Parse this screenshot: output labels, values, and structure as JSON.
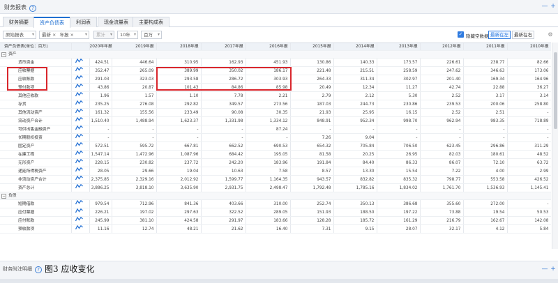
{
  "header": {
    "title": "财务报表"
  },
  "tabs": [
    "财务摘要",
    "资产负债表",
    "利润表",
    "现金流量表",
    "主要构成表"
  ],
  "toolbar": {
    "report_type": "原始报表",
    "chip_latest": "最新",
    "chip_annual": "年报",
    "period_placeholder": "累计",
    "count": "10年",
    "unit": "百万",
    "hide_empty_label": "隐藏空数据",
    "latest_left": "最新在左",
    "latest_right": "最新在右"
  },
  "table": {
    "columns": [
      "资产负债表(单位：百万)",
      "",
      "2020年年报",
      "2019年报",
      "2018年报",
      "2017年报",
      "2016年报",
      "2015年报",
      "2014年报",
      "2013年报",
      "2012年报",
      "2011年报",
      "2010年报"
    ],
    "rows": [
      {
        "type": "section",
        "name": "资产"
      },
      {
        "name": "货币资金",
        "values": [
          "424.51",
          "446.64",
          "310.95",
          "162.93",
          "451.93",
          "130.86",
          "140.33",
          "173.57",
          "226.61",
          "238.77",
          "82.66"
        ]
      },
      {
        "name": "应收票据",
        "values": [
          "352.47",
          "265.09",
          "389.99",
          "350.02",
          "186.17",
          "221.48",
          "215.51",
          "258.59",
          "247.62",
          "346.63",
          "173.06"
        ]
      },
      {
        "name": "应收账款",
        "values": [
          "291.03",
          "323.03",
          "293.58",
          "286.72",
          "303.93",
          "264.33",
          "311.34",
          "302.97",
          "201.40",
          "169.34",
          "164.96"
        ]
      },
      {
        "name": "预付款项",
        "values": [
          "43.86",
          "20.87",
          "101.43",
          "84.86",
          "85.98",
          "20.49",
          "12.34",
          "11.27",
          "42.74",
          "22.88",
          "36.27"
        ]
      },
      {
        "name": "其他应收款",
        "values": [
          "1.96",
          "1.57",
          "1.10",
          "7.78",
          "2.21",
          "2.79",
          "2.12",
          "5.30",
          "2.52",
          "3.17",
          "3.14"
        ]
      },
      {
        "name": "存货",
        "values": [
          "235.25",
          "276.08",
          "292.82",
          "349.57",
          "273.56",
          "187.03",
          "244.73",
          "230.86",
          "239.53",
          "200.06",
          "258.80"
        ]
      },
      {
        "name": "其他流动资产",
        "values": [
          "161.32",
          "155.56",
          "233.49",
          "90.08",
          "30.35",
          "21.93",
          "25.95",
          "16.15",
          "2.52",
          "2.51",
          "-"
        ]
      },
      {
        "name": "流动资产合计",
        "values": [
          "1,510.40",
          "1,488.94",
          "1,623.37",
          "1,331.98",
          "1,334.12",
          "848.91",
          "952.34",
          "998.70",
          "962.94",
          "983.35",
          "718.89"
        ]
      },
      {
        "name": "可供出售金融资产",
        "values": [
          "-",
          "-",
          "-",
          "-",
          "87.24",
          "-",
          "-",
          "-",
          "-",
          "-",
          "-"
        ]
      },
      {
        "name": "长期股权投资",
        "values": [
          "-",
          "-",
          "-",
          "-",
          "-",
          "7.26",
          "9.04",
          "-",
          "-",
          "-",
          "-"
        ]
      },
      {
        "name": "固定资产",
        "values": [
          "572.51",
          "595.72",
          "667.81",
          "662.52",
          "690.53",
          "654.32",
          "705.84",
          "706.50",
          "623.45",
          "296.86",
          "311.29"
        ]
      },
      {
        "name": "在建工程",
        "values": [
          "1,547.14",
          "1,472.96",
          "1,087.96",
          "684.42",
          "195.05",
          "81.58",
          "20.25",
          "26.95",
          "82.03",
          "180.61",
          "48.52"
        ]
      },
      {
        "name": "无形资产",
        "values": [
          "228.15",
          "230.82",
          "237.72",
          "242.20",
          "183.96",
          "191.84",
          "84.40",
          "86.33",
          "86.07",
          "72.10",
          "63.72"
        ]
      },
      {
        "name": "递延所得税资产",
        "values": [
          "28.05",
          "29.66",
          "19.04",
          "10.63",
          "7.58",
          "8.57",
          "13.30",
          "15.54",
          "7.22",
          "4.00",
          "2.99"
        ]
      },
      {
        "name": "非流动资产合计",
        "values": [
          "2,375.85",
          "2,329.16",
          "2,012.92",
          "1,599.77",
          "1,164.35",
          "943.57",
          "832.82",
          "835.32",
          "798.77",
          "553.58",
          "426.52"
        ]
      },
      {
        "name": "资产总计",
        "values": [
          "3,886.25",
          "3,818.10",
          "3,635.90",
          "2,931.75",
          "2,498.47",
          "1,792.48",
          "1,785.16",
          "1,834.02",
          "1,761.70",
          "1,536.93",
          "1,145.41"
        ]
      },
      {
        "type": "section",
        "name": "负债"
      },
      {
        "name": "短期借款",
        "values": [
          "979.54",
          "712.96",
          "841.36",
          "403.66",
          "310.00",
          "252.74",
          "350.13",
          "386.68",
          "355.60",
          "272.00",
          "-"
        ]
      },
      {
        "name": "应付票据",
        "values": [
          "226.21",
          "197.02",
          "297.63",
          "322.52",
          "289.05",
          "151.93",
          "188.50",
          "197.22",
          "73.88",
          "19.54",
          "50.53"
        ]
      },
      {
        "name": "应付账款",
        "values": [
          "245.99",
          "381.10",
          "424.58",
          "291.97",
          "183.66",
          "128.28",
          "185.72",
          "161.29",
          "216.79",
          "162.67",
          "142.08"
        ]
      },
      {
        "name": "预收款项",
        "values": [
          "11.16",
          "12.74",
          "48.21",
          "21.62",
          "16.40",
          "7.31",
          "9.15",
          "28.07",
          "32.17",
          "4.12",
          "5.84"
        ]
      }
    ]
  },
  "bottom": {
    "title": "财务附注明细",
    "caption": "图3 应收变化"
  }
}
